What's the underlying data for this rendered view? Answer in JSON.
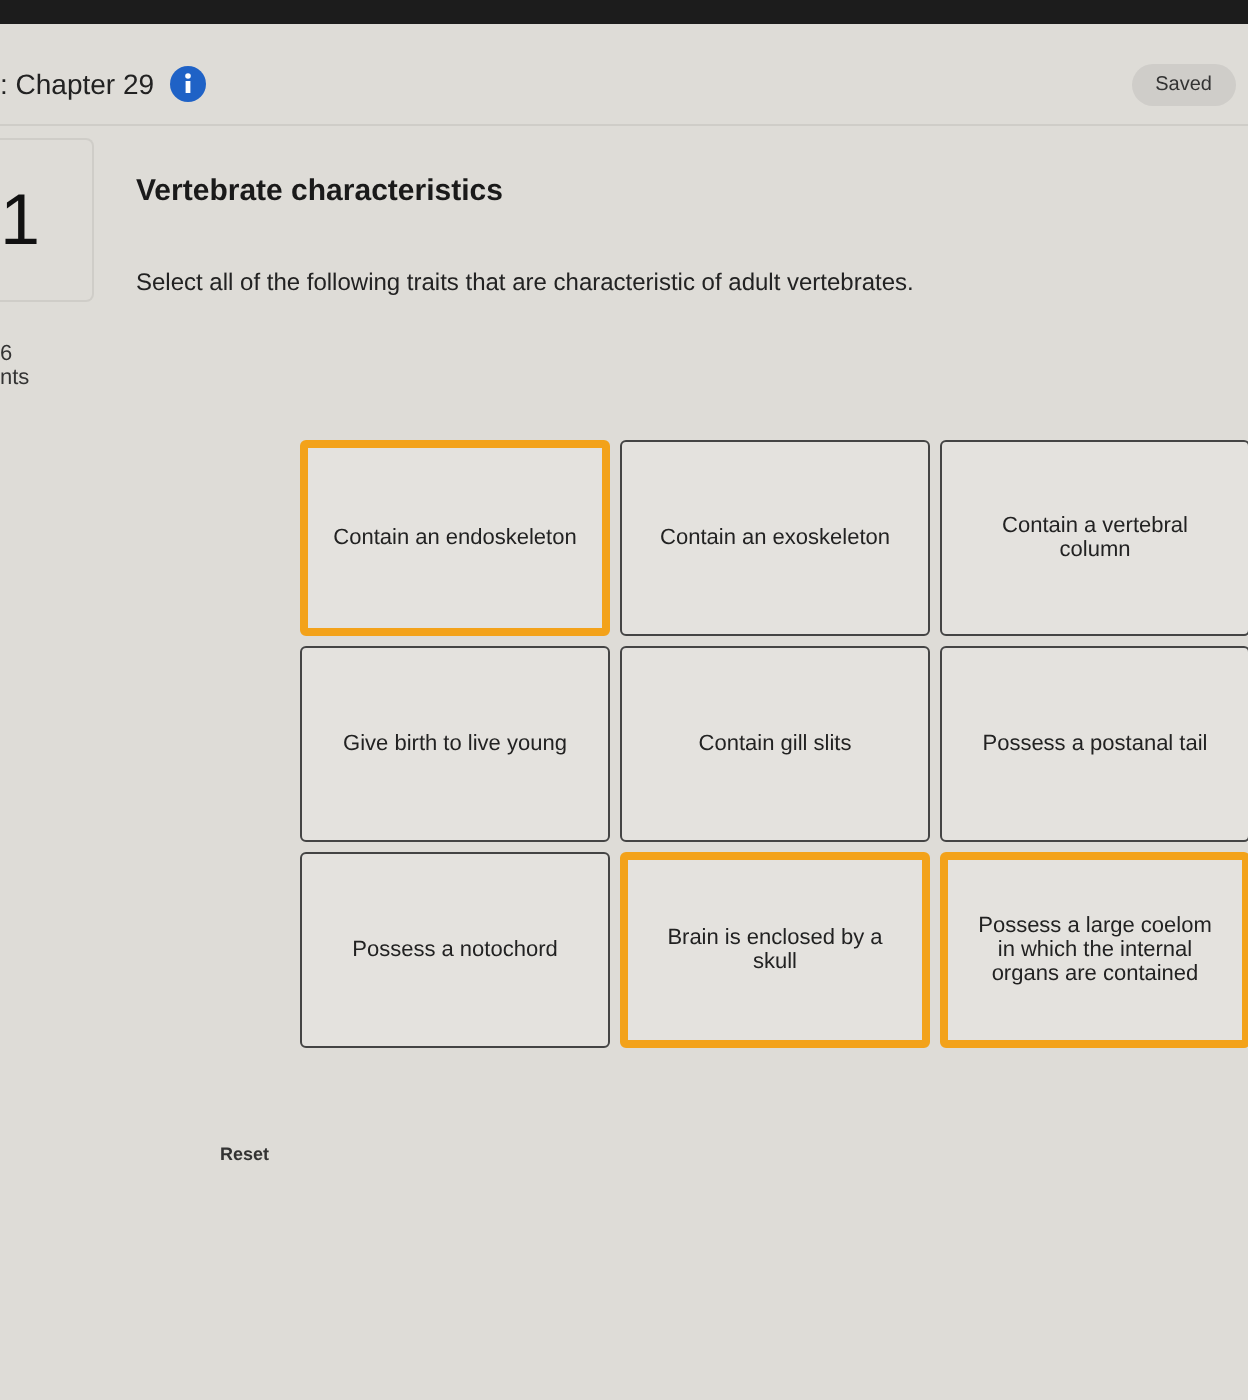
{
  "header": {
    "title": ": Chapter 29",
    "status": "Saved"
  },
  "question": {
    "number": "1",
    "points_value": "6",
    "points_label": "nts",
    "title": "Vertebrate characteristics",
    "instruction": "Select all of the following traits that are characteristic of adult vertebrates."
  },
  "choices": [
    {
      "label": "Contain an endoskeleton",
      "selected": true
    },
    {
      "label": "Contain an exoskeleton",
      "selected": false
    },
    {
      "label": "Contain a vertebral column",
      "selected": false
    },
    {
      "label": "Give birth to live young",
      "selected": false
    },
    {
      "label": "Contain gill slits",
      "selected": false
    },
    {
      "label": "Possess a postanal tail",
      "selected": false
    },
    {
      "label": "Possess a notochord",
      "selected": false
    },
    {
      "label": "Brain is enclosed by a skull",
      "selected": true
    },
    {
      "label": "Possess a large coelom in which the internal organs are contained",
      "selected": true
    }
  ],
  "reset_label": "Reset"
}
